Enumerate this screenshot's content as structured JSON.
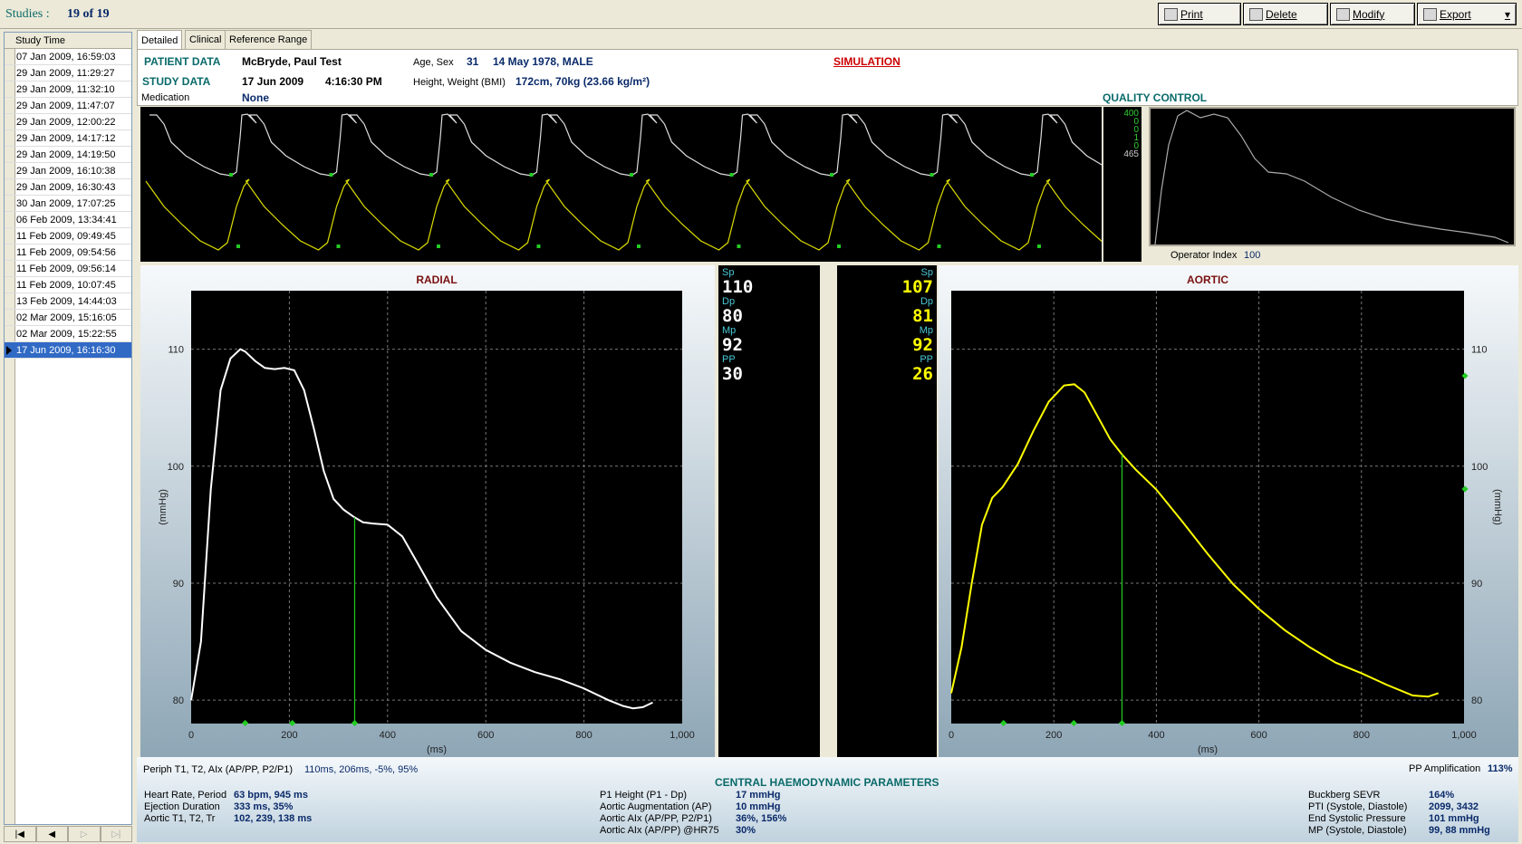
{
  "header": {
    "studies_label": "Studies :",
    "studies_count": "19 of 19"
  },
  "toolbar": {
    "print": "Print",
    "delete": "Delete",
    "modify": "Modify",
    "export": "Export"
  },
  "study_list": {
    "column": "Study Time",
    "items": [
      "07 Jan 2009, 16:59:03",
      "29 Jan 2009, 11:29:27",
      "29 Jan 2009, 11:32:10",
      "29 Jan 2009, 11:47:07",
      "29 Jan 2009, 12:00:22",
      "29 Jan 2009, 14:17:12",
      "29 Jan 2009, 14:19:50",
      "29 Jan 2009, 16:10:38",
      "29 Jan 2009, 16:30:43",
      "30 Jan 2009, 17:07:25",
      "06 Feb 2009, 13:34:41",
      "11 Feb 2009, 09:49:45",
      "11 Feb 2009, 09:54:56",
      "11 Feb 2009, 09:56:14",
      "11 Feb 2009, 10:07:45",
      "13 Feb 2009, 14:44:03",
      "02 Mar 2009, 15:16:05",
      "02 Mar 2009, 15:22:55",
      "17 Jun 2009, 16:16:30"
    ],
    "selected_index": 18,
    "nav": [
      "|◀",
      "◀",
      "▷",
      "▷|"
    ]
  },
  "tabs": [
    "Detailed",
    "Clinical",
    "Reference Range"
  ],
  "patient": {
    "patient_label": "PATIENT DATA",
    "name": "McBryde, Paul Test",
    "age_sex_label": "Age, Sex",
    "age": "31",
    "dob_sex": "14 May 1978, MALE",
    "simulation": "SIMULATION",
    "study_label": "STUDY DATA",
    "study_date": "17 Jun 2009",
    "study_time": "4:16:30 PM",
    "hw_label": "Height, Weight (BMI)",
    "hw_value": "172cm, 70kg (23.66 kg/m²)",
    "medication_label": "Medication",
    "medication": "None",
    "qc_label": "QUALITY CONTROL"
  },
  "quality_control": {
    "numbers": [
      "400",
      "0",
      "0",
      "1",
      "0",
      "465"
    ],
    "operator_label": "Operator Index",
    "operator_value": "100"
  },
  "radial": {
    "title": "RADIAL",
    "ylabel": "(mmHg)",
    "xlabel": "(ms)",
    "yticks": [
      "110",
      "100",
      "90",
      "80"
    ],
    "xticks": [
      "0",
      "200",
      "400",
      "600",
      "800",
      "1,000"
    ]
  },
  "aortic": {
    "title": "AORTIC",
    "ylabel": "(mmHg)",
    "xlabel": "(ms)",
    "yticks": [
      "110",
      "100",
      "90",
      "80"
    ],
    "xticks": [
      "0",
      "200",
      "400",
      "600",
      "800",
      "1,000"
    ]
  },
  "radial_values": [
    {
      "label": "Sp",
      "value": "110"
    },
    {
      "label": "Dp",
      "value": "80"
    },
    {
      "label": "Mp",
      "value": "92"
    },
    {
      "label": "PP",
      "value": "30"
    }
  ],
  "aortic_values": [
    {
      "label": "Sp",
      "value": "107"
    },
    {
      "label": "Dp",
      "value": "81"
    },
    {
      "label": "Mp",
      "value": "92"
    },
    {
      "label": "PP",
      "value": "26"
    }
  ],
  "bottom": {
    "periph_label": "Periph T1, T2, AIx (AP/PP, P2/P1)",
    "periph_value": "110ms, 206ms, -5%, 95%",
    "ppamp_label": "PP Amplification",
    "ppamp_value": "113%",
    "central_title": "CENTRAL HAEMODYNAMIC PARAMETERS",
    "col1": [
      {
        "label": "Heart Rate, Period",
        "value": "63 bpm, 945 ms"
      },
      {
        "label": "Ejection Duration",
        "value": "333 ms, 35%"
      },
      {
        "label": "Aortic T1, T2, Tr",
        "value": "102, 239, 138 ms"
      }
    ],
    "col2": [
      {
        "label": "P1 Height (P1 - Dp)",
        "value": "17 mmHg"
      },
      {
        "label": "Aortic Augmentation (AP)",
        "value": "10 mmHg"
      },
      {
        "label": "Aortic AIx (AP/PP, P2/P1)",
        "value": "36%, 156%"
      },
      {
        "label": "Aortic AIx (AP/PP) @HR75",
        "value": "30%"
      }
    ],
    "col3": [
      {
        "label": "Buckberg SEVR",
        "value": "164%"
      },
      {
        "label": "PTI (Systole, Diastole)",
        "value": "2099, 3432"
      },
      {
        "label": "End Systolic Pressure",
        "value": "101 mmHg"
      },
      {
        "label": "MP (Systole, Diastole)",
        "value": "99, 88 mmHg"
      }
    ]
  },
  "chart_data": [
    {
      "type": "line",
      "title": "RADIAL",
      "xlabel": "(ms)",
      "ylabel": "(mmHg)",
      "xlim": [
        0,
        1000
      ],
      "ylim": [
        78,
        115
      ],
      "series": [
        {
          "color": "#ffffff",
          "x": [
            0,
            20,
            40,
            60,
            80,
            100,
            110,
            130,
            150,
            170,
            190,
            210,
            230,
            250,
            270,
            290,
            310,
            330,
            350,
            370,
            400,
            430,
            460,
            500,
            550,
            600,
            650,
            700,
            750,
            800,
            850,
            880,
            900,
            920,
            940
          ],
          "y": [
            80,
            85,
            98,
            106.5,
            109.2,
            110,
            109.8,
            109.0,
            108.4,
            108.3,
            108.4,
            108.2,
            106.5,
            103.2,
            99.6,
            97.2,
            96.3,
            95.7,
            95.2,
            95.1,
            95.0,
            94.0,
            91.8,
            88.8,
            85.9,
            84.3,
            83.2,
            82.4,
            81.8,
            81.0,
            80.0,
            79.5,
            79.3,
            79.4,
            79.8
          ]
        }
      ],
      "markers_x": [
        110,
        206,
        333
      ]
    },
    {
      "type": "line",
      "title": "AORTIC",
      "xlabel": "(ms)",
      "ylabel": "(mmHg)",
      "xlim": [
        0,
        1000
      ],
      "ylim": [
        78,
        115
      ],
      "series": [
        {
          "color": "#ffff00",
          "x": [
            0,
            20,
            40,
            60,
            80,
            100,
            130,
            160,
            190,
            220,
            240,
            260,
            280,
            310,
            333,
            360,
            400,
            450,
            500,
            550,
            600,
            650,
            700,
            750,
            800,
            850,
            900,
            930,
            950
          ],
          "y": [
            80.6,
            84.5,
            90,
            95,
            97.3,
            98.2,
            100.2,
            103,
            105.5,
            106.9,
            107.0,
            106.3,
            104.7,
            102.3,
            101.0,
            99.7,
            98.0,
            95.3,
            92.5,
            89.9,
            87.8,
            86.0,
            84.5,
            83.2,
            82.3,
            81.3,
            80.4,
            80.3,
            80.6
          ]
        }
      ],
      "markers_x": [
        102,
        239,
        333
      ]
    }
  ]
}
